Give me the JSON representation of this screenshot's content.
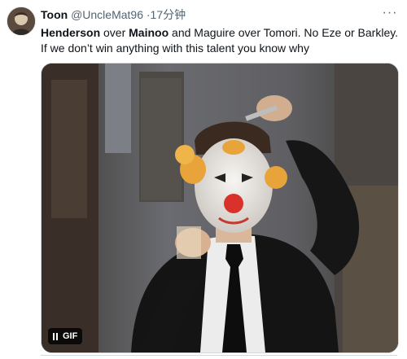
{
  "tweet": {
    "author_name": "Toon",
    "handle": "@UncleMat96",
    "separator": "·",
    "time": "17分钟",
    "more_glyph": "···",
    "text_parts": {
      "p1": "Henderson",
      "p2": " over ",
      "p3": "Mainoo",
      "p4": " and Maguire over Tomori. No Eze or Barkley. If we don’t win anything with this talent you know why"
    },
    "media": {
      "badge_label": "GIF",
      "icon": "pause-icon"
    }
  }
}
